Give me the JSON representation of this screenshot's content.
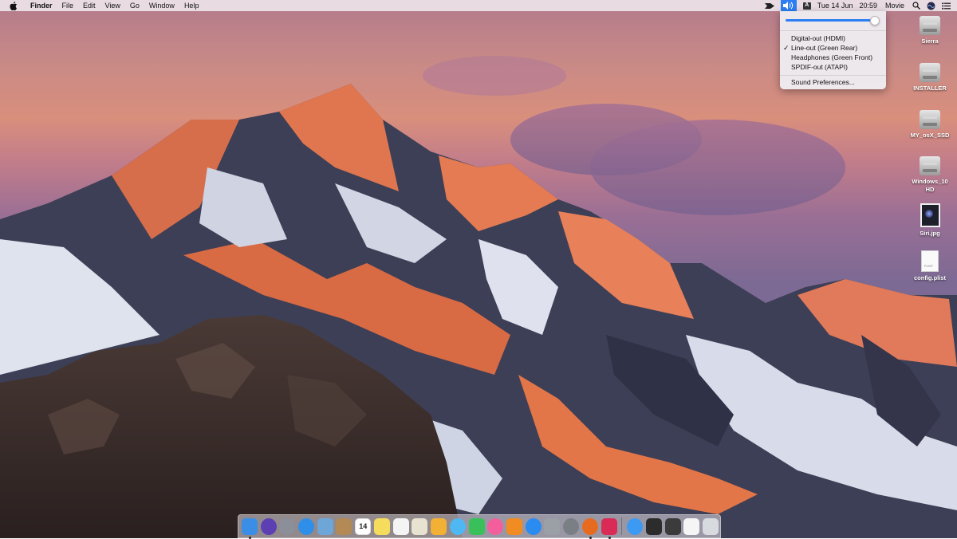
{
  "menubar": {
    "app_name": "Finder",
    "menus": [
      "File",
      "Edit",
      "View",
      "Go",
      "Window",
      "Help"
    ],
    "status": {
      "date": "Tue 14 Jun",
      "time": "20:59",
      "user": "Movie",
      "input_badge": "A"
    }
  },
  "sound_menu": {
    "volume": 0.95,
    "outputs": [
      {
        "label": "Digital-out (HDMI)",
        "checked": false
      },
      {
        "label": "Line-out (Green Rear)",
        "checked": true
      },
      {
        "label": "Headphones (Green Front)",
        "checked": false
      },
      {
        "label": "SPDIF-out (ATAPI)",
        "checked": false
      }
    ],
    "preferences_label": "Sound Preferences..."
  },
  "desktop_icons": [
    {
      "label": "Sierra",
      "kind": "drive"
    },
    {
      "label": "INSTALLER",
      "kind": "drive"
    },
    {
      "label": "MY_osX_SSD",
      "kind": "drive"
    },
    {
      "label": "Windows_10 HD",
      "kind": "drive"
    },
    {
      "label": "Siri.jpg",
      "kind": "image"
    },
    {
      "label": "config.plist",
      "kind": "document"
    }
  ],
  "calendar_day": "14",
  "dock": {
    "apps": [
      {
        "name": "finder-icon",
        "color": "#3a8ee6",
        "running": true
      },
      {
        "name": "siri-icon",
        "color": "#5b3fb3",
        "running": false
      },
      {
        "name": "launchpad-icon",
        "color": "#8a8f99",
        "running": false
      },
      {
        "name": "safari-icon",
        "color": "#2f8fe8",
        "running": false
      },
      {
        "name": "preview-icon",
        "color": "#6fa6d8",
        "running": false
      },
      {
        "name": "contacts-icon",
        "color": "#b38a55",
        "running": false
      },
      {
        "name": "calendar-icon",
        "color": "#ffffff",
        "running": false
      },
      {
        "name": "notes-icon",
        "color": "#f6dc5c",
        "running": false
      },
      {
        "name": "reminders-icon",
        "color": "#f4f4f4",
        "running": false
      },
      {
        "name": "textedit-icon",
        "color": "#e8e2d0",
        "running": false
      },
      {
        "name": "photos-icon",
        "color": "#f2b134",
        "running": false
      },
      {
        "name": "messages-icon",
        "color": "#4fb7f2",
        "running": false
      },
      {
        "name": "facetime-icon",
        "color": "#39c05a",
        "running": false
      },
      {
        "name": "itunes-icon",
        "color": "#f25f9c",
        "running": false
      },
      {
        "name": "ibooks-icon",
        "color": "#f08c22",
        "running": false
      },
      {
        "name": "app-store-icon",
        "color": "#2a8cf0",
        "running": false
      },
      {
        "name": "disk-utility-icon",
        "color": "#9aa0a6",
        "running": false
      },
      {
        "name": "system-preferences-icon",
        "color": "#7a7f86",
        "running": false
      },
      {
        "name": "firefox-icon",
        "color": "#e66b1f",
        "running": true
      },
      {
        "name": "hackintool-icon",
        "color": "#d92b55",
        "running": true
      }
    ],
    "extras": [
      {
        "name": "app-store-folder-icon",
        "color": "#3d9af2"
      },
      {
        "name": "terminal-icon",
        "color": "#2c2c2c"
      },
      {
        "name": "kext-utility-icon",
        "color": "#3b3b3b"
      },
      {
        "name": "document-icon",
        "color": "#f5f5f5"
      },
      {
        "name": "trash-icon",
        "color": "#d7dbe0"
      }
    ]
  }
}
